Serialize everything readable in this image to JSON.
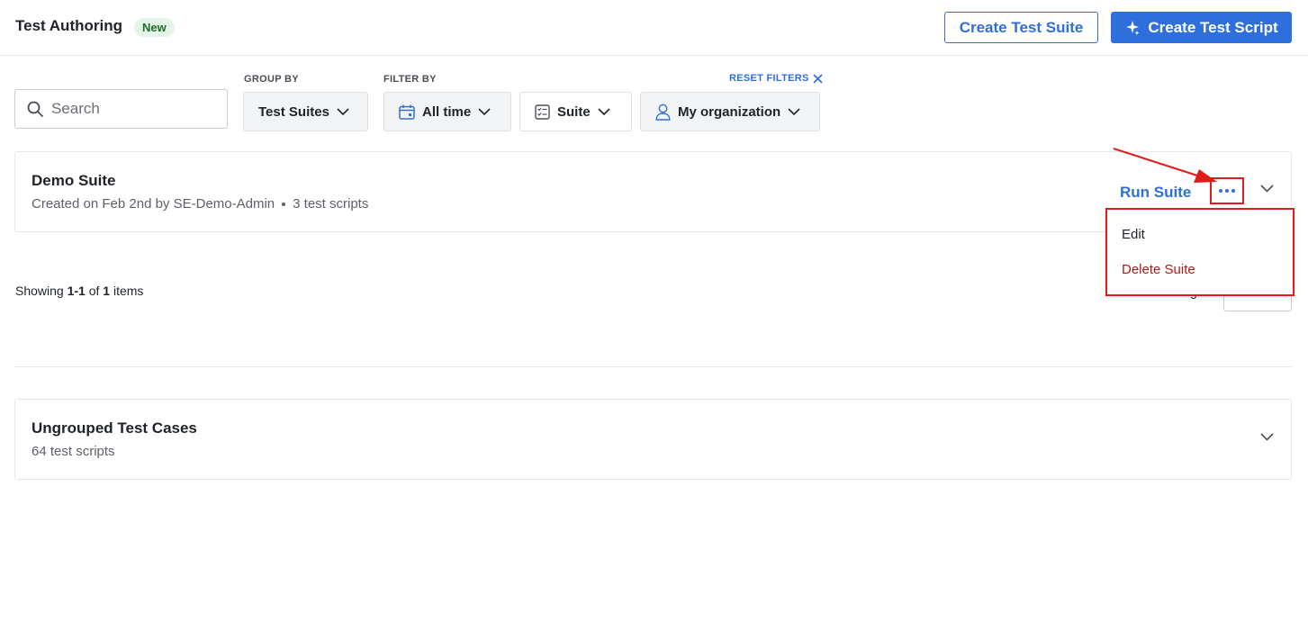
{
  "header": {
    "title": "Test Authoring",
    "badge": "New",
    "create_suite_label": "Create Test Suite",
    "create_script_label": "Create Test Script"
  },
  "filters": {
    "search_placeholder": "Search",
    "group_by_label": "GROUP BY",
    "filter_by_label": "FILTER BY",
    "reset_label": "RESET FILTERS",
    "group_by_value": "Test Suites",
    "time_value": "All time",
    "type_value": "Suite",
    "org_value": "My organization"
  },
  "suite_card": {
    "title": "Demo Suite",
    "created": "Created on Feb 2nd by SE-Demo-Admin",
    "count": "3 test scripts",
    "run_label": "Run Suite"
  },
  "menu": {
    "items": [
      {
        "label": "Edit"
      },
      {
        "label": "Delete Suite"
      }
    ]
  },
  "pagination": {
    "showing_prefix": "Showing",
    "range": "1-1",
    "of": "of",
    "total": "1",
    "suffix": "items",
    "per_page_fragment": "g"
  },
  "ungrouped_card": {
    "title": "Ungrouped Test Cases",
    "count": "64 test scripts"
  },
  "colors": {
    "accent": "#2f6fdb",
    "danger": "#b21818",
    "annotation": "#e11a1a"
  }
}
